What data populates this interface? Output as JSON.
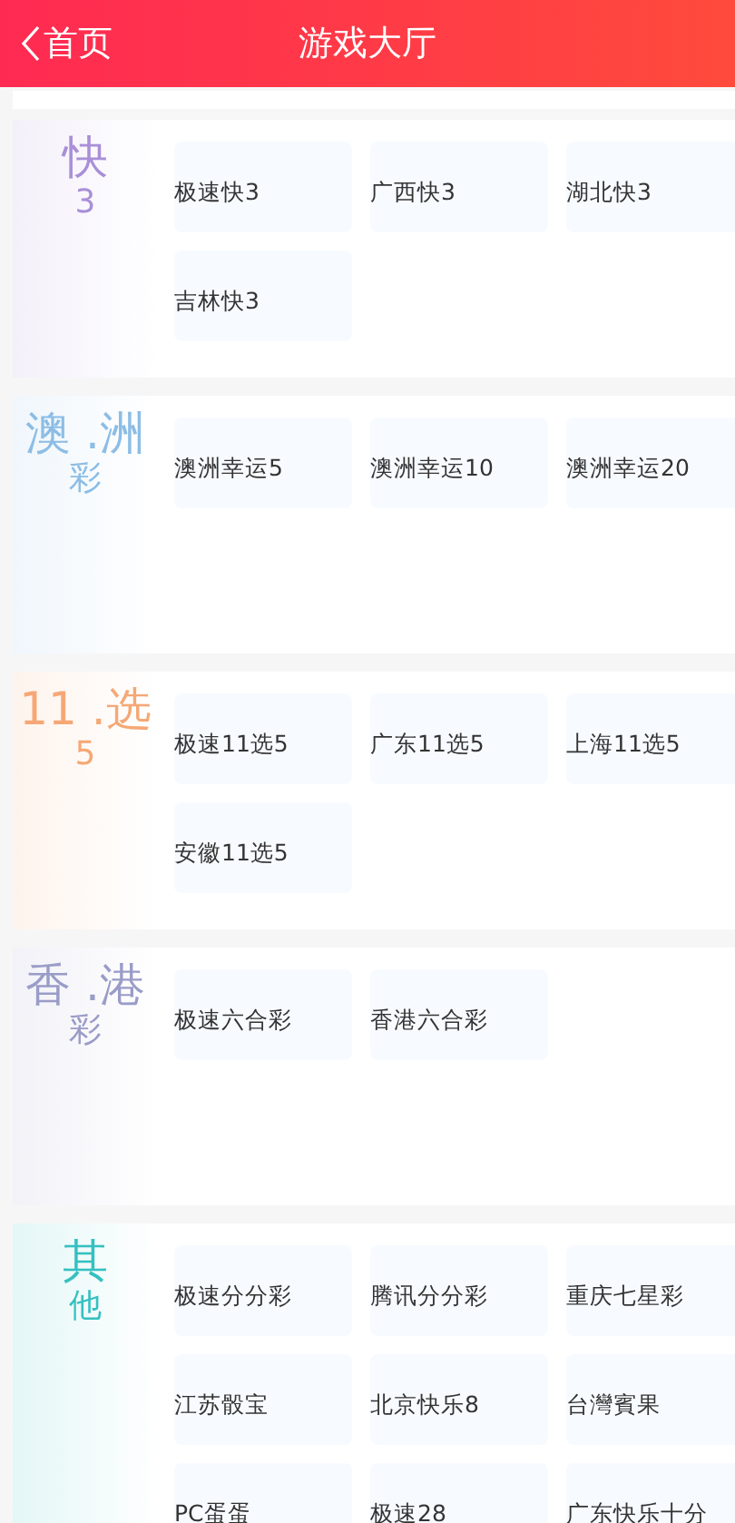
{
  "header": {
    "back_label": "首页",
    "title": "游戏大厅"
  },
  "sections": [
    {
      "label_main": "快",
      "label_sub": "3",
      "color": "#a98fd8",
      "items": [
        "极速快3",
        "广西快3",
        "湖北快3",
        "吉林快3"
      ]
    },
    {
      "label_main": "澳 .洲",
      "label_sub": "彩",
      "color": "#8cbde6",
      "items": [
        "澳洲幸运5",
        "澳洲幸运10",
        "澳洲幸运20"
      ]
    },
    {
      "label_main": "11 .选",
      "label_sub": "5",
      "color": "#f5a875",
      "items": [
        "极速11选5",
        "广东11选5",
        "上海11选5",
        "安徽11选5"
      ]
    },
    {
      "label_main": "香 .港",
      "label_sub": "彩",
      "color": "#9a9cc8",
      "items": [
        "极速六合彩",
        "香港六合彩"
      ]
    },
    {
      "label_main": "其",
      "label_sub": "他",
      "color": "#35c0c0",
      "items": [
        "极速分分彩",
        "腾讯分分彩",
        "重庆七星彩",
        "江苏骰宝",
        "北京快乐8",
        "台灣賓果",
        "PC蛋蛋",
        "极速28",
        "广东快乐十分"
      ]
    }
  ]
}
